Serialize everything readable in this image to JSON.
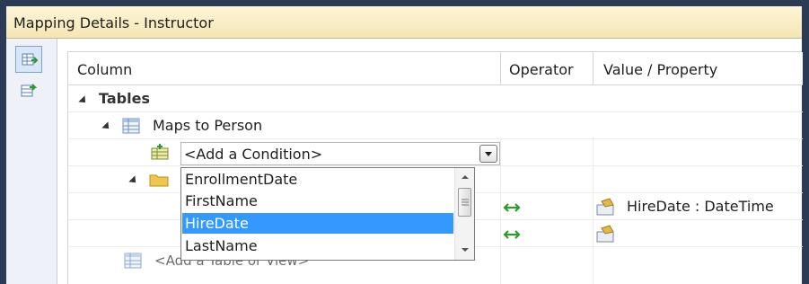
{
  "window": {
    "title": "Mapping Details - Instructor"
  },
  "toolstrip": {
    "buttons": [
      "map-entity-to-tables-icon",
      "map-entity-to-functions-icon"
    ]
  },
  "grid": {
    "headers": {
      "column": "Column",
      "operator": "Operator",
      "value": "Value / Property"
    },
    "tables_label": "Tables",
    "maps_to": "Maps to Person",
    "add_condition": "<Add a Condition>",
    "add_table": "<Add a Table or View>",
    "rows": [
      {
        "operator": "↔",
        "value": "HireDate : DateTime"
      },
      {
        "operator": "↔",
        "value": ""
      }
    ]
  },
  "dropdown": {
    "options": [
      "EnrollmentDate",
      "FirstName",
      "HireDate",
      "LastName"
    ],
    "selected": "HireDate"
  },
  "colors": {
    "selection": "#3399ff",
    "arrow": "#2e9a2e",
    "titlebar": "#f4e6b4"
  }
}
